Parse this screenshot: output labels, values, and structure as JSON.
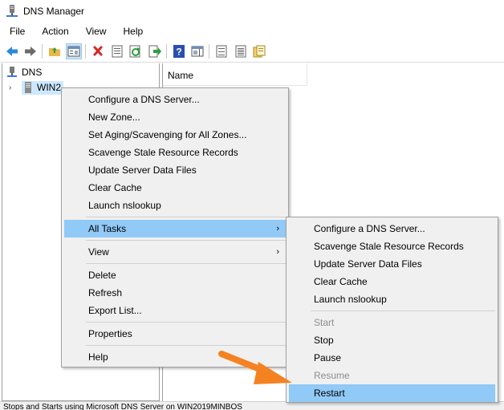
{
  "window": {
    "title": "DNS Manager"
  },
  "menubar": [
    "File",
    "Action",
    "View",
    "Help"
  ],
  "toolbar": {
    "buttons": [
      "back-icon",
      "forward-icon",
      "up-folder-icon",
      "show-hide-tree-icon",
      "delete-icon",
      "properties-icon",
      "refresh-icon",
      "export-list-icon",
      "help-icon",
      "action-pane-icon",
      "list-view-icon",
      "detail-view-icon"
    ]
  },
  "tree": {
    "root": "DNS",
    "server": "WIN2"
  },
  "list": {
    "column_name": "Name"
  },
  "status": "Stops and Starts using Microsoft DNS Server on WIN2019MINBOS",
  "context_menu": {
    "group1": [
      "Configure a DNS Server...",
      "New Zone...",
      "Set Aging/Scavenging for All Zones...",
      "Scavenge Stale Resource Records",
      "Update Server Data Files",
      "Clear Cache",
      "Launch nslookup"
    ],
    "all_tasks": "All Tasks",
    "view": "View",
    "group3": [
      "Delete",
      "Refresh",
      "Export List..."
    ],
    "properties": "Properties",
    "help": "Help"
  },
  "submenu": {
    "group1": [
      "Configure a DNS Server...",
      "Scavenge Stale Resource Records",
      "Update Server Data Files",
      "Clear Cache",
      "Launch nslookup"
    ],
    "start": "Start",
    "stop": "Stop",
    "pause": "Pause",
    "resume": "Resume",
    "restart": "Restart"
  },
  "colors": {
    "highlight": "#91c9f7",
    "menu_bg": "#f0f0f0",
    "annotation_arrow": "#f58220",
    "disabled_text": "#8d8d8d"
  }
}
